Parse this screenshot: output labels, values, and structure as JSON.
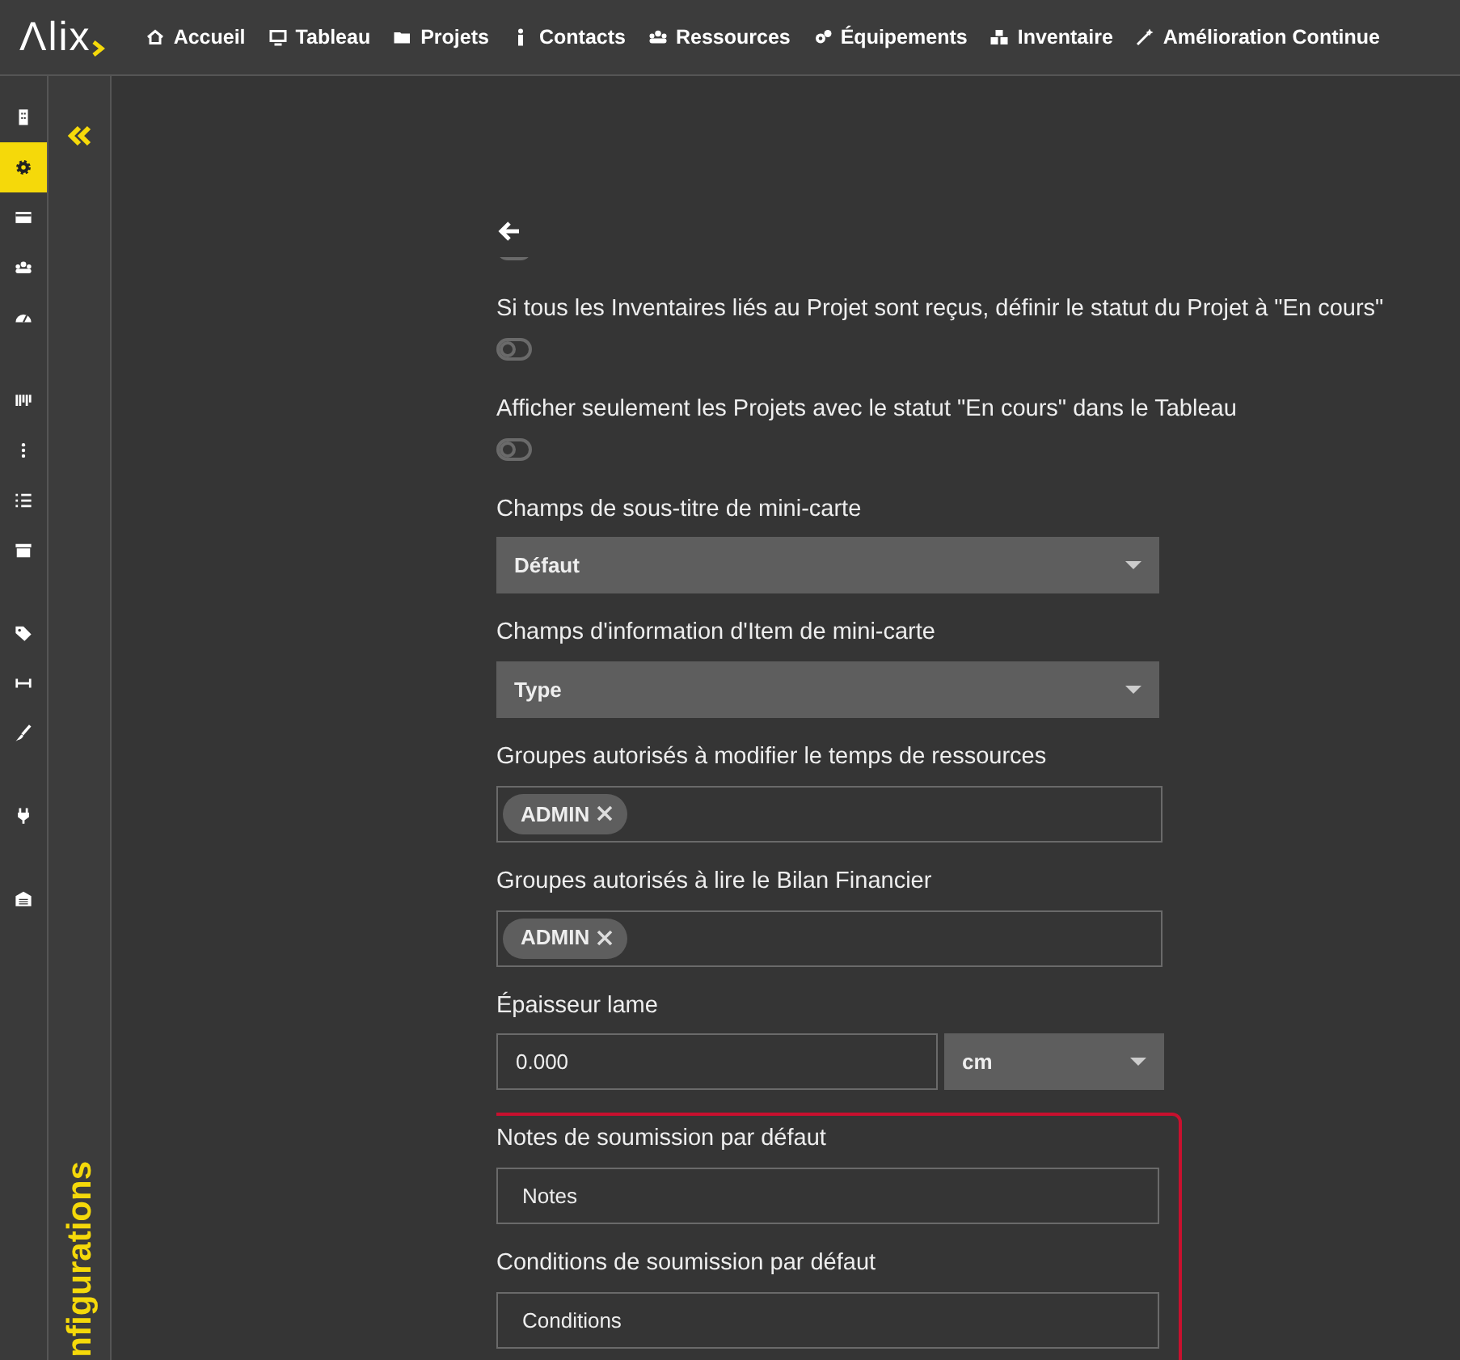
{
  "nav": {
    "logo": "Λlix",
    "items": [
      {
        "label": "Accueil"
      },
      {
        "label": "Tableau"
      },
      {
        "label": "Projets"
      },
      {
        "label": "Contacts"
      },
      {
        "label": "Ressources"
      },
      {
        "label": "Équipements"
      },
      {
        "label": "Inventaire"
      },
      {
        "label": "Amélioration Continue"
      }
    ]
  },
  "sidebar": {
    "items": [
      {
        "selected": false
      },
      {
        "selected": true
      },
      {
        "selected": false
      },
      {
        "selected": false
      },
      {
        "selected": false
      },
      {
        "selected": false
      },
      {
        "selected": false
      },
      {
        "selected": false
      },
      {
        "selected": false
      },
      {
        "selected": false
      },
      {
        "selected": false
      },
      {
        "selected": false
      },
      {
        "selected": false
      },
      {
        "selected": false
      }
    ]
  },
  "panel": {
    "title": "nfigurations"
  },
  "fields": [
    {
      "kind": "toggle",
      "on": false
    },
    {
      "kind": "toggle",
      "label": "Si tous les Inventaires liés au Projet sont reçus, définir le statut du Projet à \"En cours\"",
      "on": false
    },
    {
      "kind": "toggle",
      "label": "Afficher seulement les Projets avec le statut \"En cours\" dans le Tableau",
      "on": false
    },
    {
      "kind": "select",
      "label": "Champs de sous-titre de mini-carte",
      "value": "Défaut"
    },
    {
      "kind": "select",
      "label": "Champs d'information d'Item de mini-carte",
      "value": "Type"
    },
    {
      "kind": "tags",
      "label": "Groupes autorisés à modifier le temps de ressources",
      "tags": [
        "ADMIN"
      ]
    },
    {
      "kind": "tags",
      "label": "Groupes autorisés à lire le Bilan Financier",
      "tags": [
        "ADMIN"
      ]
    },
    {
      "kind": "number_unit",
      "label": "Épaisseur lame",
      "value": "0.000",
      "unit": "cm"
    }
  ],
  "highlighted_fields": [
    {
      "kind": "text",
      "label": "Notes de soumission par défaut",
      "value": "Notes"
    },
    {
      "kind": "text",
      "label": "Conditions de soumission par défaut",
      "value": "Conditions"
    }
  ]
}
